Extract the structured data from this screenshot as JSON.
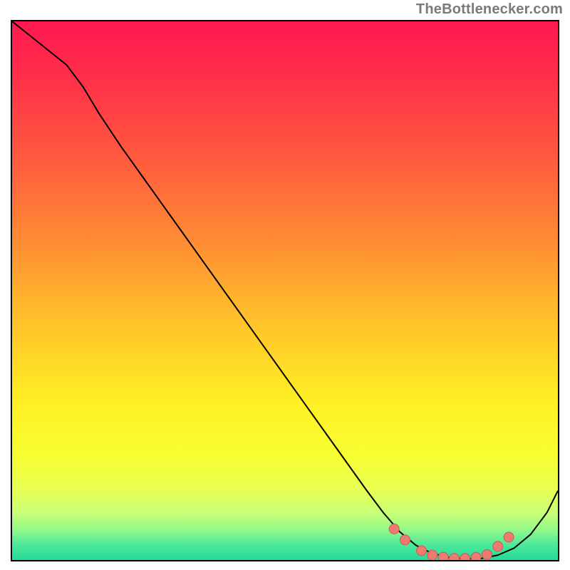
{
  "attribution": "TheBottlenecker.com",
  "chart_data": {
    "type": "line",
    "title": "",
    "xlabel": "",
    "ylabel": "",
    "xlim": [
      0,
      100
    ],
    "ylim": [
      0,
      100
    ],
    "series": [
      {
        "name": "curve",
        "x": [
          0,
          5,
          10,
          13,
          16,
          20,
          25,
          30,
          35,
          40,
          45,
          50,
          55,
          60,
          65,
          68,
          71,
          74,
          77,
          80,
          83,
          86,
          89,
          92,
          95,
          98,
          100
        ],
        "y": [
          100,
          96,
          92,
          88,
          83,
          77,
          70,
          63,
          56,
          49,
          42,
          35,
          28,
          21,
          14,
          10,
          6.5,
          4,
          2.5,
          1.8,
          1.5,
          1.6,
          2.2,
          3.5,
          6,
          10,
          14
        ]
      },
      {
        "name": "markers",
        "x": [
          70,
          72,
          75,
          77,
          79,
          81,
          83,
          85,
          87,
          89,
          91
        ],
        "y": [
          7,
          5,
          3,
          2.2,
          1.8,
          1.6,
          1.6,
          1.8,
          2.3,
          3.8,
          5.5
        ]
      }
    ],
    "gradient_stops": [
      {
        "offset": 0.0,
        "color": "#ff1850"
      },
      {
        "offset": 0.1,
        "color": "#ff2e4a"
      },
      {
        "offset": 0.25,
        "color": "#ff5a3e"
      },
      {
        "offset": 0.4,
        "color": "#ff8b34"
      },
      {
        "offset": 0.55,
        "color": "#ffc22a"
      },
      {
        "offset": 0.7,
        "color": "#fff024"
      },
      {
        "offset": 0.8,
        "color": "#f6ff33"
      },
      {
        "offset": 0.86,
        "color": "#e7ff55"
      },
      {
        "offset": 0.9,
        "color": "#c8ff76"
      },
      {
        "offset": 0.93,
        "color": "#96f988"
      },
      {
        "offset": 0.96,
        "color": "#4be89a"
      },
      {
        "offset": 1.0,
        "color": "#16d39a"
      }
    ],
    "curve_stroke": "#000000",
    "marker_fill": "#ee7a70",
    "marker_stroke": "#cc5a50",
    "marker_radius_px": 7
  }
}
